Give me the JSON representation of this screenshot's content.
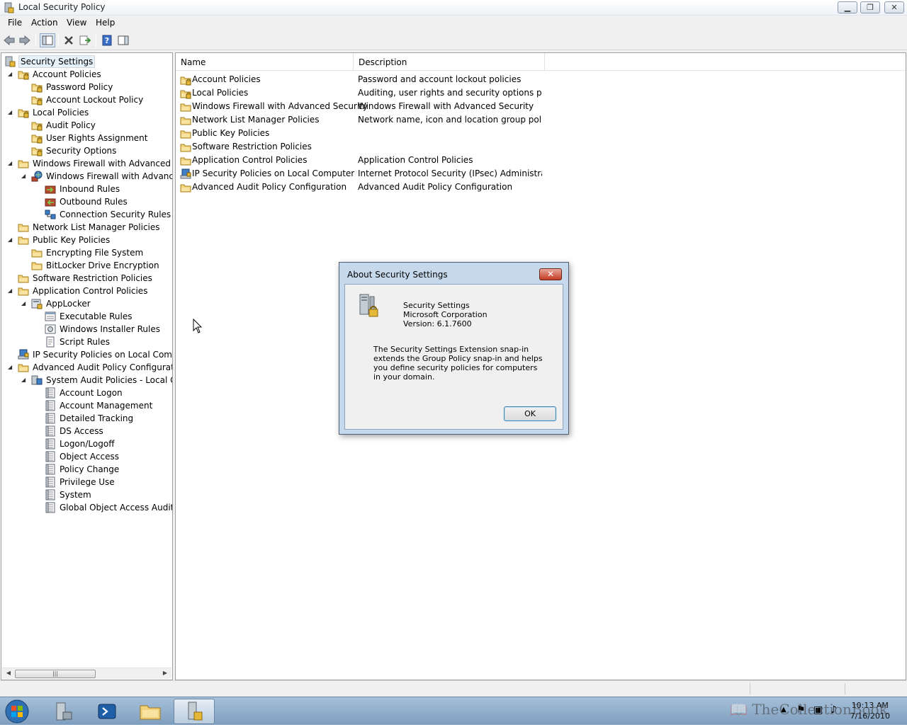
{
  "window": {
    "title": "Local Security Policy",
    "menu": [
      "File",
      "Action",
      "View",
      "Help"
    ]
  },
  "tree": {
    "root": "Security Settings",
    "nodes": [
      {
        "label": "Account Policies",
        "level": 1,
        "expander": "expanded",
        "icon": "folder-lock-icon"
      },
      {
        "label": "Password Policy",
        "level": 2,
        "expander": "none",
        "icon": "folder-lock-icon"
      },
      {
        "label": "Account Lockout Policy",
        "level": 2,
        "expander": "none",
        "icon": "folder-lock-icon"
      },
      {
        "label": "Local Policies",
        "level": 1,
        "expander": "expanded",
        "icon": "folder-lock-icon"
      },
      {
        "label": "Audit Policy",
        "level": 2,
        "expander": "none",
        "icon": "folder-lock-icon"
      },
      {
        "label": "User Rights Assignment",
        "level": 2,
        "expander": "none",
        "icon": "folder-lock-icon"
      },
      {
        "label": "Security Options",
        "level": 2,
        "expander": "none",
        "icon": "folder-lock-icon"
      },
      {
        "label": "Windows Firewall with Advanced Secu",
        "level": 1,
        "expander": "expanded",
        "icon": "folder-icon"
      },
      {
        "label": "Windows Firewall with Advanced",
        "level": 2,
        "expander": "expanded",
        "icon": "firewall-icon"
      },
      {
        "label": "Inbound Rules",
        "level": 3,
        "expander": "none",
        "icon": "inbound-rules-icon"
      },
      {
        "label": "Outbound Rules",
        "level": 3,
        "expander": "none",
        "icon": "outbound-rules-icon"
      },
      {
        "label": "Connection Security Rules",
        "level": 3,
        "expander": "none",
        "icon": "connection-rules-icon"
      },
      {
        "label": "Network List Manager Policies",
        "level": 1,
        "expander": "none",
        "icon": "folder-icon"
      },
      {
        "label": "Public Key Policies",
        "level": 1,
        "expander": "expanded",
        "icon": "folder-icon"
      },
      {
        "label": "Encrypting File System",
        "level": 2,
        "expander": "none",
        "icon": "folder-icon"
      },
      {
        "label": "BitLocker Drive Encryption",
        "level": 2,
        "expander": "none",
        "icon": "folder-icon"
      },
      {
        "label": "Software Restriction Policies",
        "level": 1,
        "expander": "none",
        "icon": "folder-icon"
      },
      {
        "label": "Application Control Policies",
        "level": 1,
        "expander": "expanded",
        "icon": "folder-icon"
      },
      {
        "label": "AppLocker",
        "level": 2,
        "expander": "expanded",
        "icon": "applocker-icon"
      },
      {
        "label": "Executable Rules",
        "level": 3,
        "expander": "none",
        "icon": "rules-list-icon"
      },
      {
        "label": "Windows Installer Rules",
        "level": 3,
        "expander": "none",
        "icon": "installer-rules-icon"
      },
      {
        "label": "Script Rules",
        "level": 3,
        "expander": "none",
        "icon": "script-rules-icon"
      },
      {
        "label": "IP Security Policies on Local Compute",
        "level": 1,
        "expander": "none",
        "icon": "ipsec-icon"
      },
      {
        "label": "Advanced Audit Policy Configuration",
        "level": 1,
        "expander": "expanded",
        "icon": "folder-icon"
      },
      {
        "label": "System Audit Policies - Local Grou",
        "level": 2,
        "expander": "expanded",
        "icon": "audit-policies-icon"
      },
      {
        "label": "Account Logon",
        "level": 3,
        "expander": "none",
        "icon": "audit-category-icon"
      },
      {
        "label": "Account Management",
        "level": 3,
        "expander": "none",
        "icon": "audit-category-icon"
      },
      {
        "label": "Detailed Tracking",
        "level": 3,
        "expander": "none",
        "icon": "audit-category-icon"
      },
      {
        "label": "DS Access",
        "level": 3,
        "expander": "none",
        "icon": "audit-category-icon"
      },
      {
        "label": "Logon/Logoff",
        "level": 3,
        "expander": "none",
        "icon": "audit-category-icon"
      },
      {
        "label": "Object Access",
        "level": 3,
        "expander": "none",
        "icon": "audit-category-icon"
      },
      {
        "label": "Policy Change",
        "level": 3,
        "expander": "none",
        "icon": "audit-category-icon"
      },
      {
        "label": "Privilege Use",
        "level": 3,
        "expander": "none",
        "icon": "audit-category-icon"
      },
      {
        "label": "System",
        "level": 3,
        "expander": "none",
        "icon": "audit-category-icon"
      },
      {
        "label": "Global Object Access Auditing",
        "level": 3,
        "expander": "none",
        "icon": "audit-category-icon"
      }
    ]
  },
  "list": {
    "columns": [
      "Name",
      "Description"
    ],
    "rows": [
      {
        "name": "Account Policies",
        "description": "Password and account lockout policies",
        "icon": "folder-lock-icon"
      },
      {
        "name": "Local Policies",
        "description": "Auditing, user rights and security options polici...",
        "icon": "folder-lock-icon"
      },
      {
        "name": "Windows Firewall with Advanced Security",
        "description": "Windows Firewall with Advanced Security",
        "icon": "folder-icon"
      },
      {
        "name": "Network List Manager Policies",
        "description": "Network name, icon and location group policies.",
        "icon": "folder-icon"
      },
      {
        "name": "Public Key Policies",
        "description": "",
        "icon": "folder-icon"
      },
      {
        "name": "Software Restriction Policies",
        "description": "",
        "icon": "folder-icon"
      },
      {
        "name": "Application Control Policies",
        "description": "Application Control Policies",
        "icon": "folder-icon"
      },
      {
        "name": "IP Security Policies on Local Computer",
        "description": "Internet Protocol Security (IPsec) Administratio...",
        "icon": "ipsec-icon"
      },
      {
        "name": "Advanced Audit Policy Configuration",
        "description": "Advanced Audit Policy Configuration",
        "icon": "folder-icon"
      }
    ]
  },
  "dialog": {
    "title": "About Security Settings",
    "close_label": "✕",
    "product": "Security Settings",
    "company": "Microsoft Corporation",
    "version": "Version: 6.1.7600",
    "description": "The Security Settings Extension snap-in extends the Group Policy snap-in and helps you define security policies for computers in your domain.",
    "ok_label": "OK"
  },
  "taskbar": {
    "clock_time": "10:13 AM",
    "clock_date": "7/16/2010"
  },
  "watermark": "TheCollectionBook",
  "colors": {
    "folder": "#f2d27a",
    "selection_accent": "#3399ff",
    "dialog_frame": "#c6d9ec",
    "close_red": "#c43b25",
    "taskbar": "#8fadcc"
  }
}
